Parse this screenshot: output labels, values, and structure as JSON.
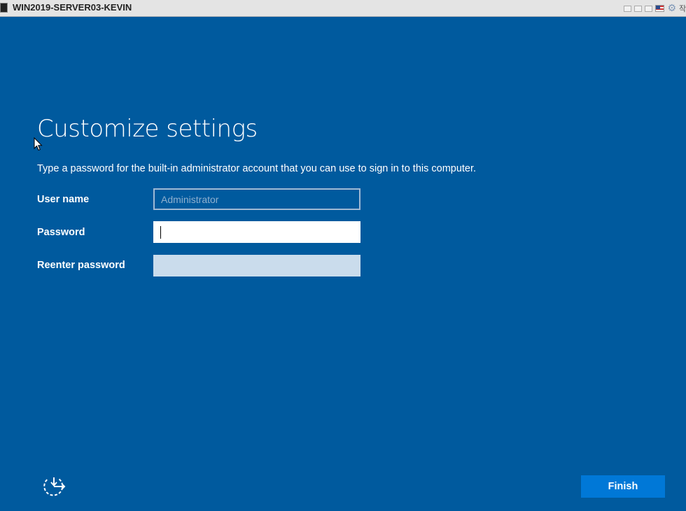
{
  "window": {
    "title": "WIN2019-SERVER03-KEVIN",
    "lang_indicator": "작업"
  },
  "page": {
    "heading": "Customize settings",
    "description": "Type a password for the built-in administrator account that you can use to sign in to this computer."
  },
  "form": {
    "username_label": "User name",
    "username_placeholder": "Administrator",
    "password_label": "Password",
    "reenter_label": "Reenter password"
  },
  "buttons": {
    "finish_label": "Finish"
  },
  "icons": {
    "ease_of_access": "ease-of-access-icon",
    "cursor": "mouse-pointer-icon"
  },
  "colors": {
    "background": "#005a9e",
    "accent_button": "#0078d7"
  }
}
